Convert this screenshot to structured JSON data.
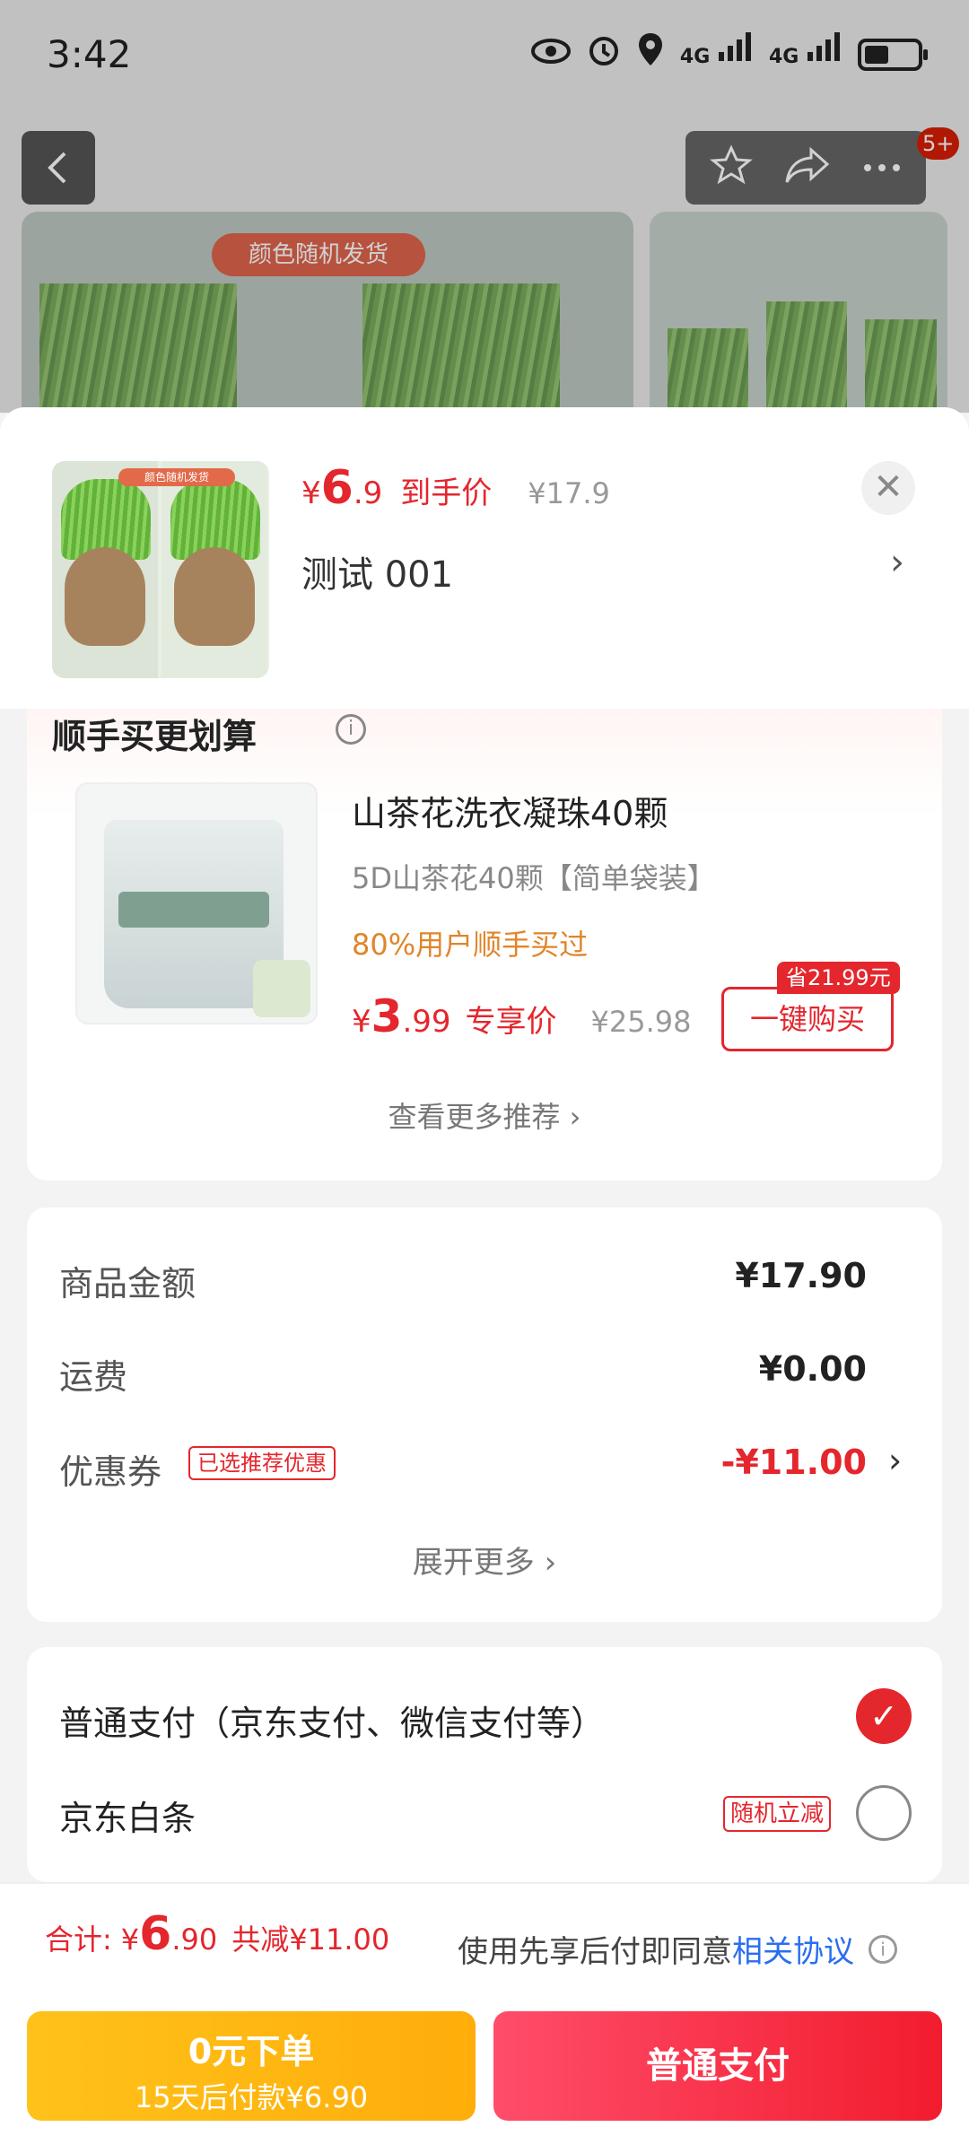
{
  "status_bar": {
    "time": "3:42",
    "network_a": "4G",
    "network_b": "4G"
  },
  "top_nav": {
    "badge": "5+",
    "image_tag": "颜色随机发货"
  },
  "sheet_header": {
    "thumb_tag": "颜色随机发货",
    "price_yen": "¥",
    "price_int": "6",
    "price_dec": ".9",
    "price_label": "到手价",
    "original_price": "¥17.9",
    "spec": "测试  001",
    "close_symbol": "✕",
    "arrow": "›"
  },
  "addon": {
    "title": "顺手买更划算",
    "info_symbol": "i",
    "product_name": "山茶花洗衣凝珠40颗",
    "product_spec": "5D山茶花40颗【简单袋装】",
    "social_proof": "80%用户顺手买过",
    "price_yen": "¥",
    "price_int": "3",
    "price_dec": ".99",
    "price_label": "专享价",
    "original_price": "¥25.98",
    "save_badge": "省21.99元",
    "buy_button": "一键购买",
    "more_link": "查看更多推荐 ›"
  },
  "amounts": {
    "rows": [
      {
        "label": "商品金额",
        "value": "¥17.90"
      },
      {
        "label": "运费",
        "value": "¥0.00"
      },
      {
        "label": "优惠券",
        "value": "-¥11.00"
      }
    ],
    "coupon_tag": "已选推荐优惠",
    "arrow": "›",
    "expand_link": "展开更多 ›"
  },
  "payment": {
    "option_normal": "普通支付（京东支付、微信支付等）",
    "option_baitiao": "京东白条",
    "baitiao_tag": "随机立减",
    "check_symbol": "✓"
  },
  "footer": {
    "total_label": "合计:",
    "total_yen": "¥",
    "total_int": "6",
    "total_dec": ".90",
    "total_save": "共减¥11.00",
    "agree_text": "使用先享后付即同意",
    "agree_link": "相关协议",
    "info_symbol": "i",
    "later_line1": "0元下单",
    "later_line2": "15天后付款¥6.90",
    "pay_button": "普通支付"
  },
  "colors": {
    "accent": "#e4262d",
    "later_button": "#ffb612",
    "pay_button": "#f21c2e"
  }
}
